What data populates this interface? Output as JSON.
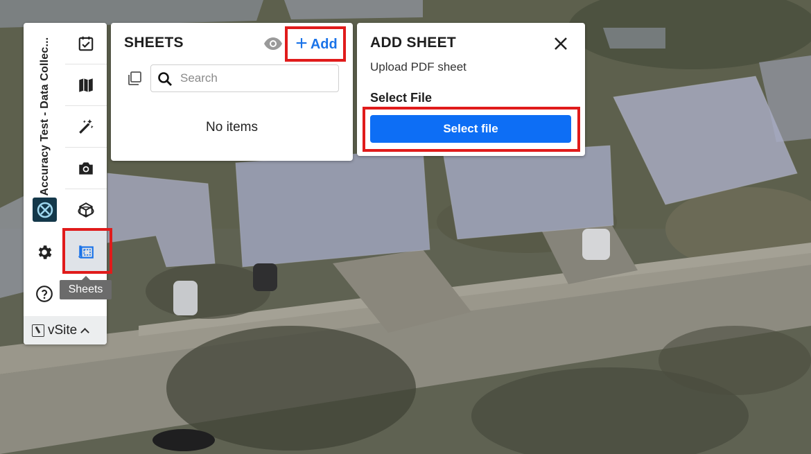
{
  "project": {
    "title": "Accuracy Test - Data Collec..."
  },
  "rail": {
    "items": [
      {
        "name": "tasks",
        "icon": "checklist-icon"
      },
      {
        "name": "map",
        "icon": "map-icon"
      },
      {
        "name": "measure-tools",
        "icon": "wand-icon"
      },
      {
        "name": "photos",
        "icon": "camera-icon"
      },
      {
        "name": "models",
        "icon": "cube-icon"
      },
      {
        "name": "sheets",
        "icon": "sheets-icon",
        "active": true
      }
    ],
    "tooltip": "Sheets",
    "settings_icon": "gear-icon",
    "help_icon": "help-icon",
    "brand_icon": "vsite-logo-icon"
  },
  "footer": {
    "label": "vSite"
  },
  "sheets_panel": {
    "title": "SHEETS",
    "add_label": "Add",
    "search_placeholder": "Search",
    "empty_text": "No items"
  },
  "add_sheet_panel": {
    "title": "ADD SHEET",
    "subtitle": "Upload PDF sheet",
    "field_label": "Select File",
    "button_label": "Select file"
  },
  "colors": {
    "accent": "#0d6ef5",
    "highlight": "#e01b1b",
    "link": "#1a73e8"
  }
}
